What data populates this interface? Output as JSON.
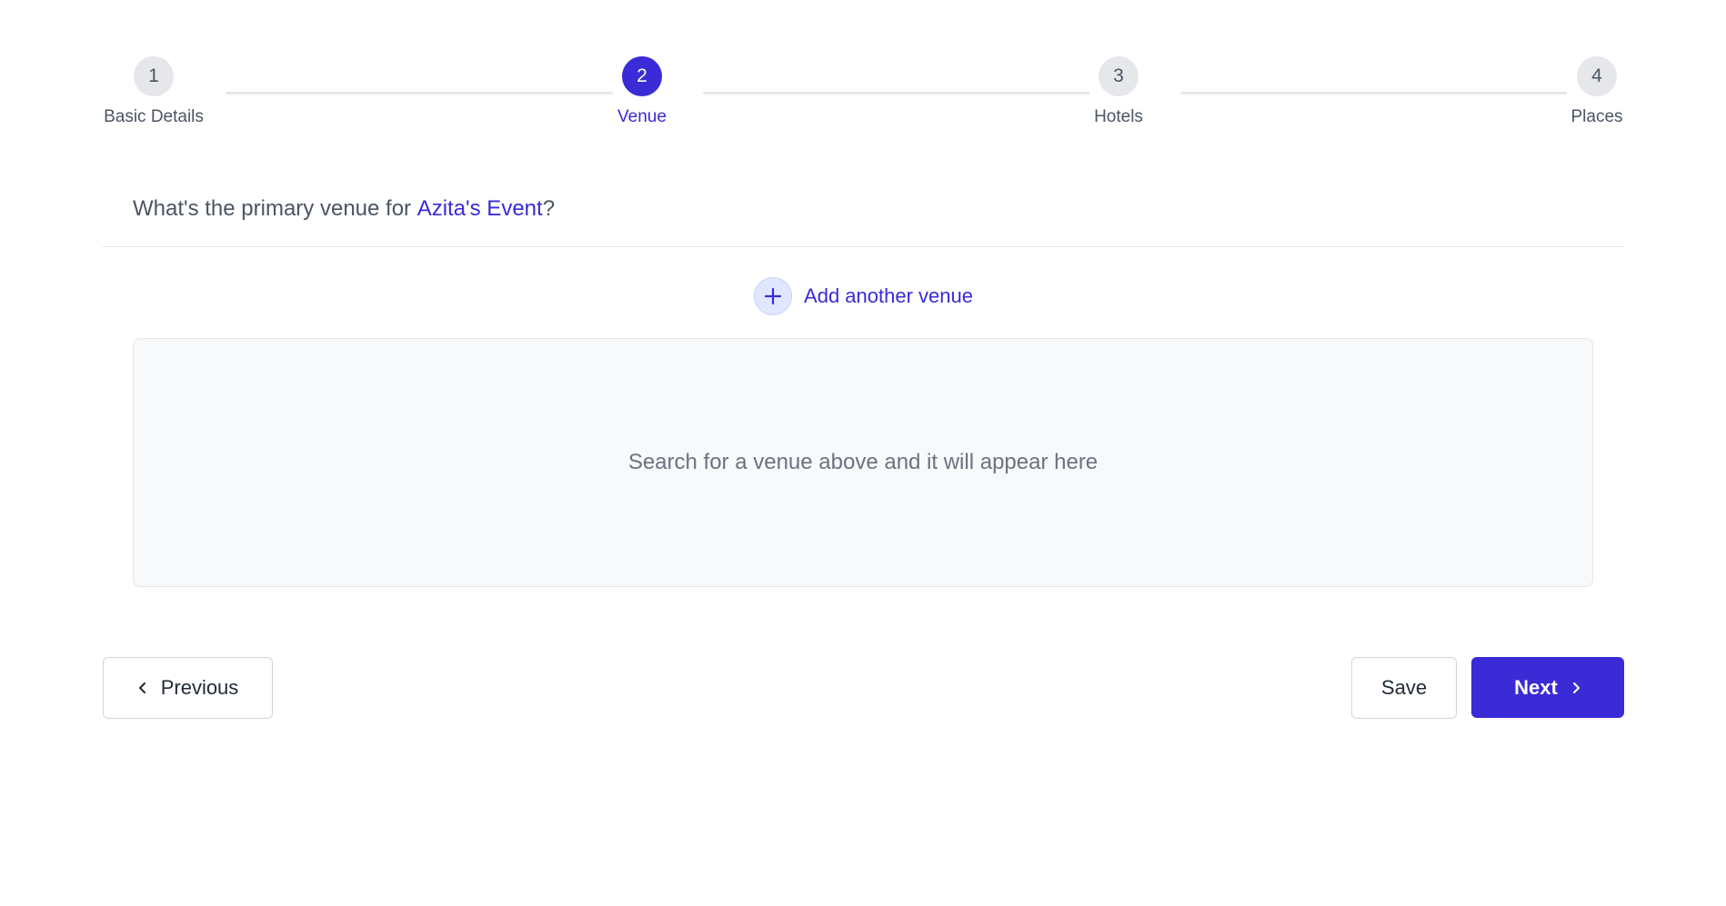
{
  "stepper": {
    "steps": [
      {
        "number": "1",
        "label": "Basic Details"
      },
      {
        "number": "2",
        "label": "Venue"
      },
      {
        "number": "3",
        "label": "Hotels"
      },
      {
        "number": "4",
        "label": "Places"
      }
    ],
    "active_step": 2
  },
  "venue_card": {
    "question_prefix": "What's the primary venue for ",
    "event_name": "Azita's Event",
    "question_suffix": "?",
    "add_venue_label": "Add another venue",
    "add_venue_icon": "plus-icon",
    "placeholder_text": "Search for a venue above and it will appear here"
  },
  "footer": {
    "previous_label": "Previous",
    "previous_icon": "chevron-left-icon",
    "save_label": "Save",
    "next_label": "Next",
    "next_icon": "chevron-right-icon"
  },
  "colors": {
    "accent": "#3a2bd6",
    "inactive_step": "#e5e7eb",
    "placeholder_bg": "#f8f9fb"
  }
}
